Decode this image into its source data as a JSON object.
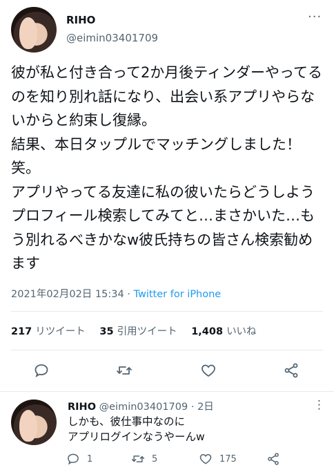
{
  "tweet": {
    "name": "RIHO",
    "handle": "@eimin03401709",
    "more": "···",
    "text": "彼が私と付き合って2か月後ティンダーやってるのを知り別れ話になり、出会い系アプリやらないからと約束し復縁。\n結果、本日タップルでマッチングしました！笑。\nアプリやってる友達に私の彼いたらどうしようプロフィール検索してみてと…まさかいた…もう別れるべきかなw彼氏持ちの皆さん検索勧めます",
    "timestamp": "2021年02月02日 15:34 · ",
    "source": "Twitter for iPhone",
    "stats": {
      "retweets": "217",
      "retweets_label": "リツイート",
      "quotes": "35",
      "quotes_label": "引用ツイート",
      "likes": "1,408",
      "likes_label": "いいね"
    },
    "action_icons": [
      "reply-icon",
      "retweet-icon",
      "like-icon",
      "share-icon"
    ]
  },
  "reply": {
    "name": "RIHO",
    "handle": "@eimin03401709",
    "time": "· 2日",
    "more": "⋮",
    "text": "しかも、彼仕事中なのに\nアプリログインなうやーんw",
    "reply_count": "1",
    "retweet_count": "5",
    "like_count": "175"
  },
  "colors": {
    "accent": "#1d9bf0",
    "text": "#0f1419",
    "muted": "#536471",
    "divider": "#e6e9ec"
  }
}
